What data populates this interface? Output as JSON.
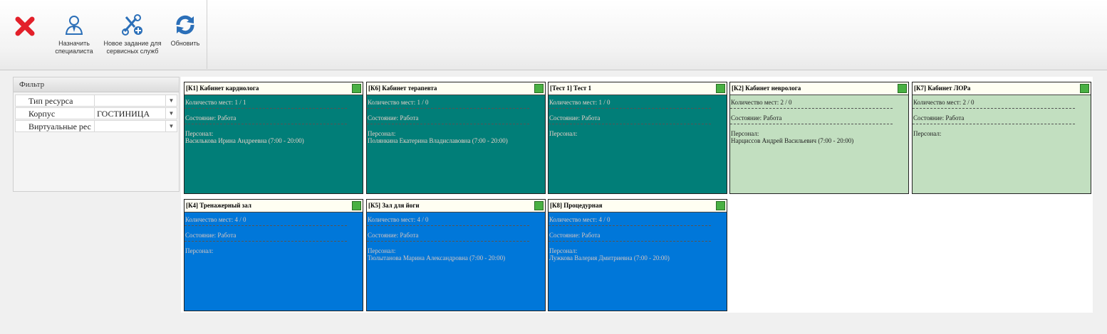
{
  "toolbar": {
    "close_icon": "close-x-icon",
    "buttons": [
      {
        "icon": "person-icon",
        "label_line1": "Назначить",
        "label_line2": "специалиста"
      },
      {
        "icon": "wrench-plus-icon",
        "label_line1": "Новое задание для",
        "label_line2": "сервисных служб"
      },
      {
        "icon": "refresh-icon",
        "label_line1": "Обновить",
        "label_line2": ""
      }
    ]
  },
  "filter": {
    "title": "Фильтр",
    "rows": [
      {
        "label": "Тип ресурса",
        "value": ""
      },
      {
        "label": "Корпус",
        "value": "ГОСТИНИЦА"
      },
      {
        "label": "Виртуальные рес",
        "value": ""
      }
    ]
  },
  "labels": {
    "seats": "Количество мест:",
    "state": "Состояние:",
    "staff": "Персонал:"
  },
  "colors": {
    "teal": "#017e78",
    "light_green": "#c2dfc0",
    "blue": "#0077d9",
    "status_square": "#49b043"
  },
  "cards": [
    {
      "title": "[К1] Кабинет кардиолога",
      "seats": "1 / 1",
      "state": "Работа",
      "staff": "Василькова Ирина Андреевна (7:00 - 20:00)",
      "color": "teal"
    },
    {
      "title": "[К6] Кабинет терапевта",
      "seats": "1 / 0",
      "state": "Работа",
      "staff": "Полянкина Екатерина Владиславовна (7:00 - 20:00)",
      "color": "teal"
    },
    {
      "title": "[Тест 1] Тест 1",
      "seats": "1 / 0",
      "state": "Работа",
      "staff": "",
      "color": "teal"
    },
    {
      "title": "[К2] Кабинет невролога",
      "seats": "2 / 0",
      "state": "Работа",
      "staff": "Нарциссов Андрей Васильевич (7:00 - 20:00)",
      "color": "light"
    },
    {
      "title": "[К7] Кабинет ЛОРа",
      "seats": "2 / 0",
      "state": "Работа",
      "staff": "",
      "color": "light"
    },
    {
      "title": "[К4] Тренажерный зал",
      "seats": "4 / 0",
      "state": "Работа",
      "staff": "",
      "color": "blue"
    },
    {
      "title": "[К5] Зал для йоги",
      "seats": "4 / 0",
      "state": "Работа",
      "staff": "Тюлытанова Марина Александровна (7:00 - 20:00)",
      "color": "blue"
    },
    {
      "title": "[К8] Процедурная",
      "seats": "4 / 0",
      "state": "Работа",
      "staff": "Лужкова Валерия Дмитриевна (7:00 - 20:00)",
      "color": "blue"
    }
  ]
}
